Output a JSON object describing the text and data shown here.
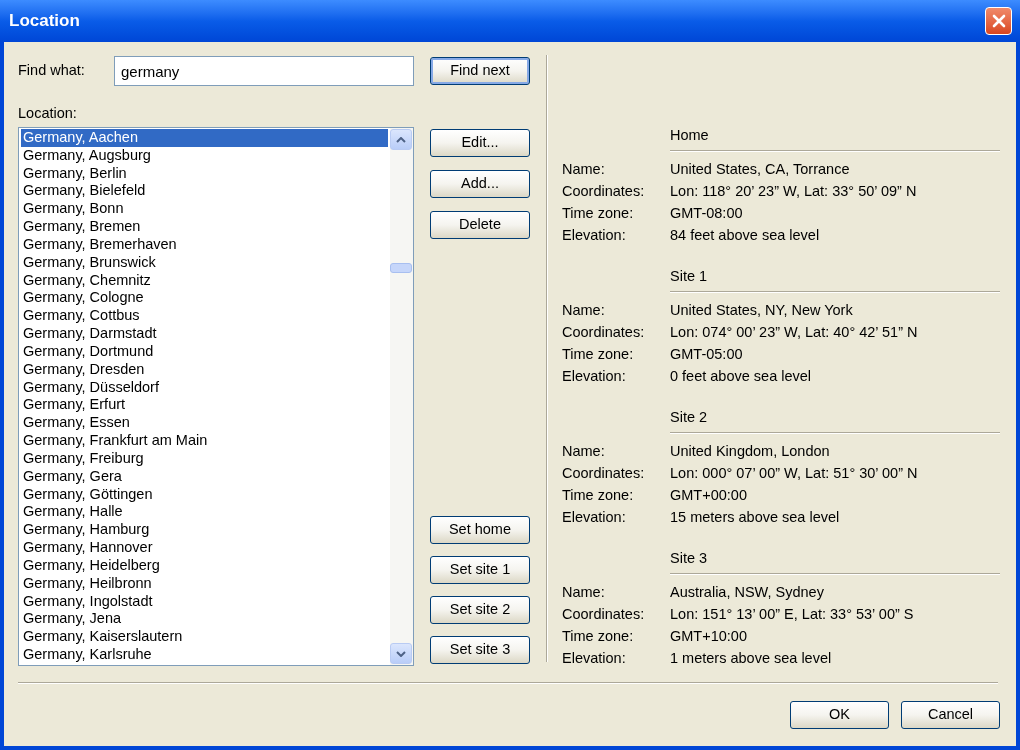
{
  "window": {
    "title": "Location"
  },
  "find": {
    "label": "Find what:",
    "value": "germany",
    "button": {
      "label": "Find next",
      "default": true
    }
  },
  "location": {
    "label": "Location:",
    "items": [
      {
        "text": "Germany, Aachen",
        "selected": true
      },
      {
        "text": "Germany, Augsburg",
        "selected": false
      },
      {
        "text": "Germany, Berlin",
        "selected": false
      },
      {
        "text": "Germany, Bielefeld",
        "selected": false
      },
      {
        "text": "Germany, Bonn",
        "selected": false
      },
      {
        "text": "Germany, Bremen",
        "selected": false
      },
      {
        "text": "Germany, Bremerhaven",
        "selected": false
      },
      {
        "text": "Germany, Brunswick",
        "selected": false
      },
      {
        "text": "Germany, Chemnitz",
        "selected": false
      },
      {
        "text": "Germany, Cologne",
        "selected": false
      },
      {
        "text": "Germany, Cottbus",
        "selected": false
      },
      {
        "text": "Germany, Darmstadt",
        "selected": false
      },
      {
        "text": "Germany, Dortmund",
        "selected": false
      },
      {
        "text": "Germany, Dresden",
        "selected": false
      },
      {
        "text": "Germany, Düsseldorf",
        "selected": false
      },
      {
        "text": "Germany, Erfurt",
        "selected": false
      },
      {
        "text": "Germany, Essen",
        "selected": false
      },
      {
        "text": "Germany, Frankfurt am Main",
        "selected": false
      },
      {
        "text": "Germany, Freiburg",
        "selected": false
      },
      {
        "text": "Germany, Gera",
        "selected": false
      },
      {
        "text": "Germany, Göttingen",
        "selected": false
      },
      {
        "text": "Germany, Halle",
        "selected": false
      },
      {
        "text": "Germany, Hamburg",
        "selected": false
      },
      {
        "text": "Germany, Hannover",
        "selected": false
      },
      {
        "text": "Germany, Heidelberg",
        "selected": false
      },
      {
        "text": "Germany, Heilbronn",
        "selected": false
      },
      {
        "text": "Germany, Ingolstadt",
        "selected": false
      },
      {
        "text": "Germany, Jena",
        "selected": false
      },
      {
        "text": "Germany, Kaiserslautern",
        "selected": false
      },
      {
        "text": "Germany, Karlsruhe",
        "selected": false
      }
    ]
  },
  "list_buttons": [
    "Edit...",
    "Add...",
    "Delete"
  ],
  "set_buttons": [
    "Set home",
    "Set site 1",
    "Set site 2",
    "Set site 3"
  ],
  "sites": [
    {
      "title": "Home",
      "fields": [
        {
          "label": "Name:",
          "value": "United States, CA, Torrance"
        },
        {
          "label": "Coordinates:",
          "value": "Lon: 118° 20’ 23” W, Lat: 33° 50’ 09” N"
        },
        {
          "label": "Time zone:",
          "value": "GMT-08:00"
        },
        {
          "label": "Elevation:",
          "value": "84 feet above sea level"
        }
      ]
    },
    {
      "title": "Site 1",
      "fields": [
        {
          "label": "Name:",
          "value": "United States, NY, New York"
        },
        {
          "label": "Coordinates:",
          "value": "Lon: 074° 00’ 23” W, Lat: 40° 42’ 51” N"
        },
        {
          "label": "Time zone:",
          "value": "GMT-05:00"
        },
        {
          "label": "Elevation:",
          "value": "0 feet above sea level"
        }
      ]
    },
    {
      "title": "Site 2",
      "fields": [
        {
          "label": "Name:",
          "value": "United Kingdom, London"
        },
        {
          "label": "Coordinates:",
          "value": "Lon: 000° 07’ 00” W, Lat: 51° 30’ 00” N"
        },
        {
          "label": "Time zone:",
          "value": "GMT+00:00"
        },
        {
          "label": "Elevation:",
          "value": "15 meters above sea level"
        }
      ]
    },
    {
      "title": "Site 3",
      "fields": [
        {
          "label": "Name:",
          "value": "Australia, NSW, Sydney"
        },
        {
          "label": "Coordinates:",
          "value": "Lon: 151° 13’ 00” E, Lat: 33° 53’ 00” S"
        },
        {
          "label": "Time zone:",
          "value": "GMT+10:00"
        },
        {
          "label": "Elevation:",
          "value": "1 meters above sea level"
        }
      ]
    }
  ],
  "footer_buttons": [
    "OK",
    "Cancel"
  ]
}
